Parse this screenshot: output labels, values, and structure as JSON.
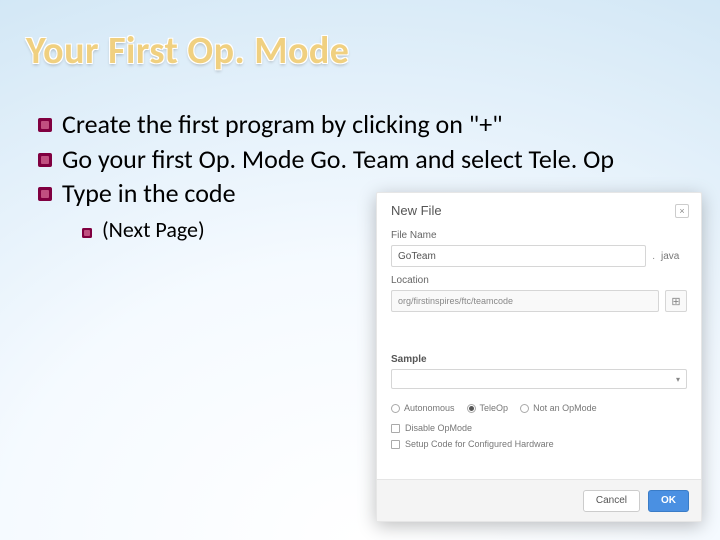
{
  "title": "Your First Op. Mode",
  "bullets": {
    "b1": "Create the first program by clicking on \"+\"",
    "b2": "Go your first Op. Mode Go. Team and select Tele. Op",
    "b3": "Type in the code",
    "sub1": "(Next Page)"
  },
  "dialog": {
    "header_title": "New File",
    "close_glyph": "×",
    "file_name_label": "File Name",
    "file_name_value": "GoTeam",
    "file_dot": ".",
    "file_ext": "java",
    "location_label": "Location",
    "location_path": "org/firstinspires/ftc/teamcode",
    "browse_glyph": "⊞",
    "sample_label": "Sample",
    "select_caret": "▾",
    "radio_autonomous": "Autonomous",
    "radio_teleop": "TeleOp",
    "radio_notop": "Not an OpMode",
    "check_disable": "Disable OpMode",
    "check_setup": "Setup Code for Configured Hardware",
    "btn_cancel": "Cancel",
    "btn_ok": "OK"
  }
}
